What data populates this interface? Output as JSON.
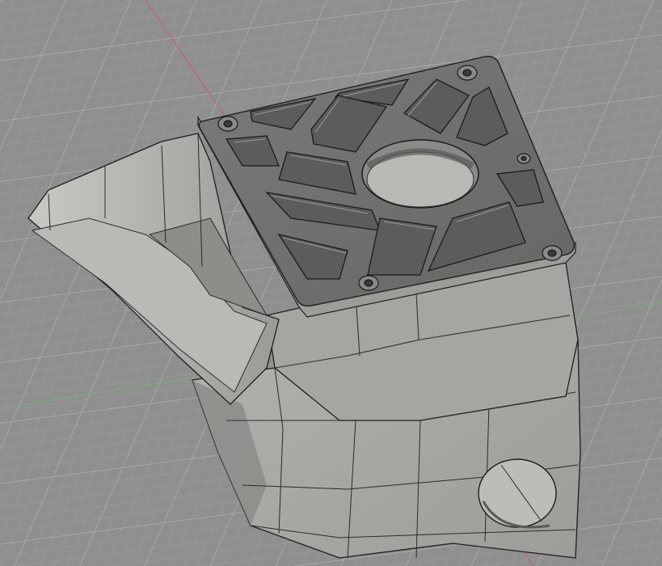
{
  "viewport": {
    "background_color": "#8f8f8f",
    "grid_minor_color": "#a3a3a3",
    "grid_major_color": "#b0b0b0",
    "axis_x_color": "#7bb07b",
    "axis_y_color": "#c06060"
  },
  "model": {
    "body_color": "#a8a8a5",
    "body_shadow_color": "#8a8a87",
    "plate_color": "#6e6e6c",
    "pocket_color": "#5a5a58",
    "edge_color": "#1e1e1e",
    "highlight_color": "#d8d8d5"
  }
}
